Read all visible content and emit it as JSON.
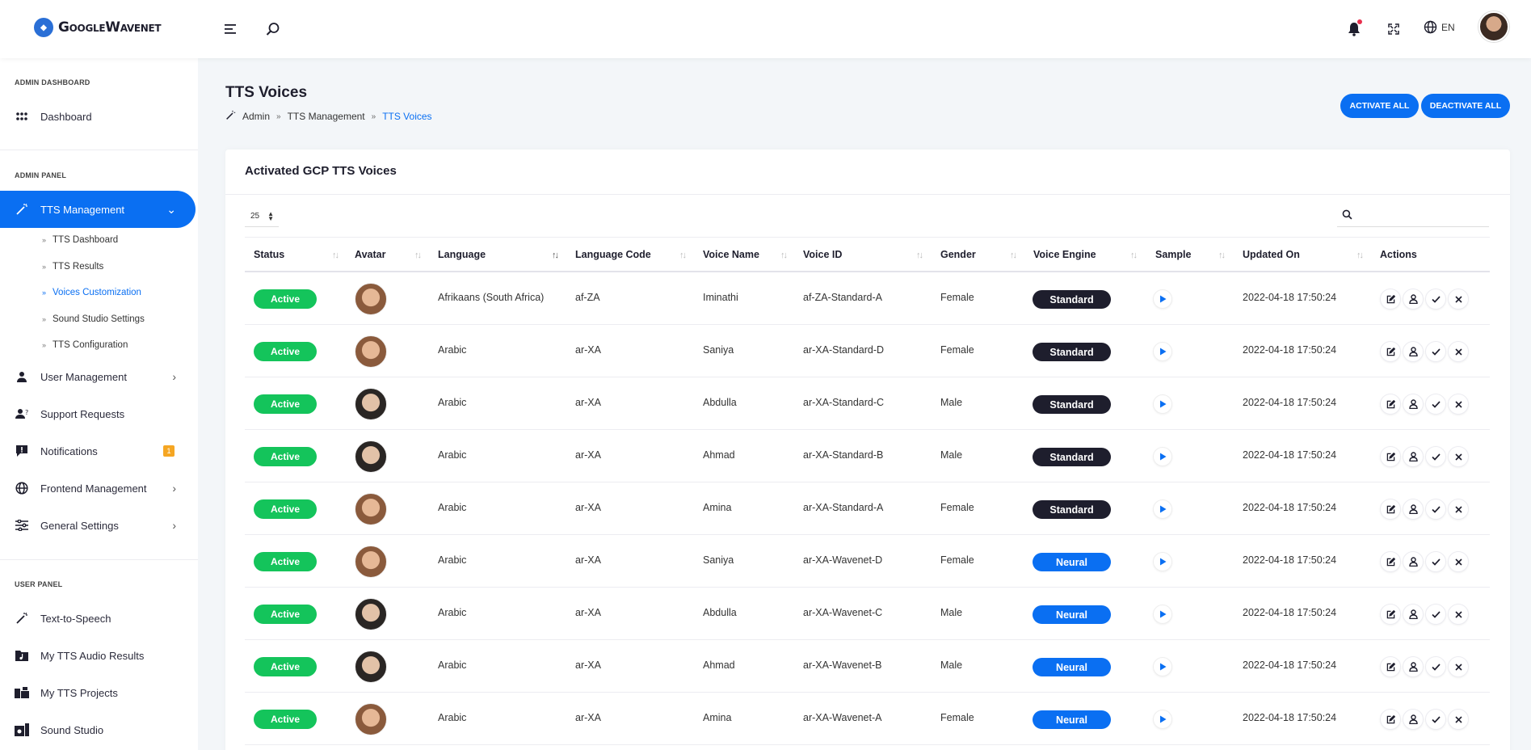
{
  "app": {
    "brand": "GoogleWavenet",
    "language": "EN"
  },
  "sidebar": {
    "sections": {
      "admin_dashboard": "ADMIN DASHBOARD",
      "admin_panel": "ADMIN PANEL",
      "user_panel": "USER PANEL"
    },
    "dashboard": "Dashboard",
    "tts_management": "TTS Management",
    "submenu": [
      "TTS Dashboard",
      "TTS Results",
      "Voices Customization",
      "Sound Studio Settings",
      "TTS Configuration"
    ],
    "user_management": "User Management",
    "support_requests": "Support Requests",
    "notifications": "Notifications",
    "notifications_count": "1",
    "frontend_management": "Frontend Management",
    "general_settings": "General Settings",
    "text_to_speech": "Text-to-Speech",
    "my_tts_audio_results": "My TTS Audio Results",
    "my_tts_projects": "My TTS Projects",
    "sound_studio": "Sound Studio"
  },
  "page": {
    "title": "TTS Voices",
    "breadcrumb": [
      "Admin",
      "TTS Management",
      "TTS Voices"
    ],
    "activate_all": "ACTIVATE ALL",
    "deactivate_all": "DEACTIVATE ALL"
  },
  "card": {
    "title": "Activated GCP TTS Voices",
    "per_page": "25"
  },
  "table": {
    "columns": [
      "Status",
      "Avatar",
      "Language",
      "Language Code",
      "Voice Name",
      "Voice ID",
      "Gender",
      "Voice Engine",
      "Sample",
      "Updated On",
      "Actions"
    ],
    "rows": [
      {
        "status": "Active",
        "language": "Afrikaans (South Africa)",
        "code": "af-ZA",
        "name": "Iminathi",
        "id": "af-ZA-Standard-A",
        "gender": "Female",
        "engine": "Standard",
        "updated": "2022-04-18 17:50:24"
      },
      {
        "status": "Active",
        "language": "Arabic",
        "code": "ar-XA",
        "name": "Saniya",
        "id": "ar-XA-Standard-D",
        "gender": "Female",
        "engine": "Standard",
        "updated": "2022-04-18 17:50:24"
      },
      {
        "status": "Active",
        "language": "Arabic",
        "code": "ar-XA",
        "name": "Abdulla",
        "id": "ar-XA-Standard-C",
        "gender": "Male",
        "engine": "Standard",
        "updated": "2022-04-18 17:50:24"
      },
      {
        "status": "Active",
        "language": "Arabic",
        "code": "ar-XA",
        "name": "Ahmad",
        "id": "ar-XA-Standard-B",
        "gender": "Male",
        "engine": "Standard",
        "updated": "2022-04-18 17:50:24"
      },
      {
        "status": "Active",
        "language": "Arabic",
        "code": "ar-XA",
        "name": "Amina",
        "id": "ar-XA-Standard-A",
        "gender": "Female",
        "engine": "Standard",
        "updated": "2022-04-18 17:50:24"
      },
      {
        "status": "Active",
        "language": "Arabic",
        "code": "ar-XA",
        "name": "Saniya",
        "id": "ar-XA-Wavenet-D",
        "gender": "Female",
        "engine": "Neural",
        "updated": "2022-04-18 17:50:24"
      },
      {
        "status": "Active",
        "language": "Arabic",
        "code": "ar-XA",
        "name": "Abdulla",
        "id": "ar-XA-Wavenet-C",
        "gender": "Male",
        "engine": "Neural",
        "updated": "2022-04-18 17:50:24"
      },
      {
        "status": "Active",
        "language": "Arabic",
        "code": "ar-XA",
        "name": "Ahmad",
        "id": "ar-XA-Wavenet-B",
        "gender": "Male",
        "engine": "Neural",
        "updated": "2022-04-18 17:50:24"
      },
      {
        "status": "Active",
        "language": "Arabic",
        "code": "ar-XA",
        "name": "Amina",
        "id": "ar-XA-Wavenet-A",
        "gender": "Female",
        "engine": "Neural",
        "updated": "2022-04-18 17:50:24"
      }
    ]
  },
  "colors": {
    "accent": "#0a6ff2",
    "active": "#14c45b",
    "standard": "#1e1e2d",
    "neural": "#0a6ff2",
    "badge": "#f5a623"
  }
}
